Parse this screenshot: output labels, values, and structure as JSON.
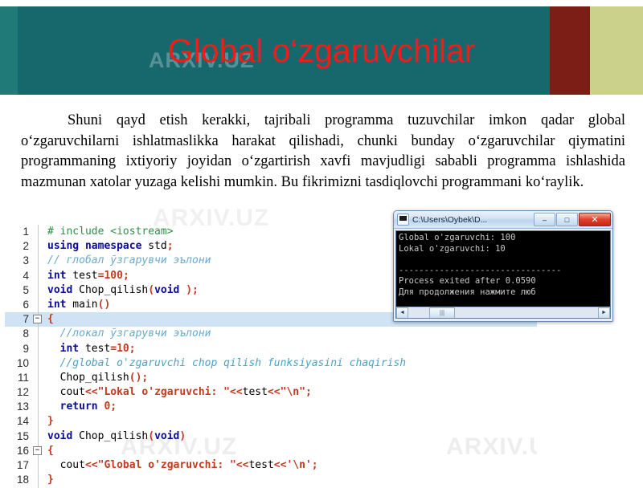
{
  "slide": {
    "title": "Global o‘zgaruvchilar",
    "watermark": "ARXIV.UZ",
    "paragraph": "Shuni qayd etish kerakki, tajribali programma tuzuvchilar imkon qadar global o‘zgaruvchilarni ishlatmaslikka harakat qilishadi, chunki bunday o‘zgaruvchilar qiymatini programmaning ixtiyoriy joyidan o‘zgartirish xavfi mavjudligi sababli programma ishlashida mazmunan xatolar yuzaga kelishi mumkin. Bu fikrimizni tasdiqlovchi programmani ko‘raylik."
  },
  "colors": {
    "title": "#ef1c1c",
    "banner_teal": "#16686d",
    "banner_left": "#1f7a78",
    "banner_red": "#7c1e15",
    "banner_olive": "#cbd18a",
    "highlight": "#cfe3f5",
    "comment": "#6aa9c9",
    "keyword": "#0b0b9c",
    "string": "#c23a1f",
    "preprocessor": "#2f8f4a"
  },
  "code": {
    "line_numbers": [
      "1",
      "2",
      "3",
      "4",
      "5",
      "6",
      "7",
      "8",
      "9",
      "10",
      "11",
      "12",
      "13",
      "14",
      "15",
      "16",
      "17",
      "18"
    ],
    "lines": [
      "# include <iostream>",
      "using namespace std;",
      "// глобал ўзгарувчи эълони",
      "int test=100;",
      "void Chop_qilish(void );",
      "int main()",
      "{",
      "  //локал ўзгарувчи эълони",
      "  int test=10;",
      "  //global o'zgaruvchi chop qilish funksiyasini chaqirish",
      "  Chop_qilish();",
      "  cout<<\"Lokal o'zgaruvchi: \"<<test<<\"\\n\";",
      "  return 0;",
      "}",
      "void Chop_qilish(void)",
      "{",
      "  cout<<\"Global o'zgaruvchi: \"<<test<<'\\n';",
      "}"
    ],
    "fold_markers": [
      "",
      "",
      "",
      "",
      "",
      "",
      "-",
      "",
      "",
      "",
      "",
      "",
      "",
      "",
      "",
      "-",
      "",
      ""
    ],
    "highlighted_line": 7
  },
  "console": {
    "title": "C:\\Users\\Oybek\\D...",
    "minimize_label": "–",
    "maximize_label": "□",
    "close_label": "✕",
    "output": "Global o'zgaruvchi: 100\nLokal o'zgaruvchi: 10\n\n--------------------------------\nProcess exited after 0.0590\nДля продолжения нажмите люб",
    "scroll_left_label": "◄",
    "scroll_right_label": "►",
    "scroll_thumb_label": "|||"
  }
}
